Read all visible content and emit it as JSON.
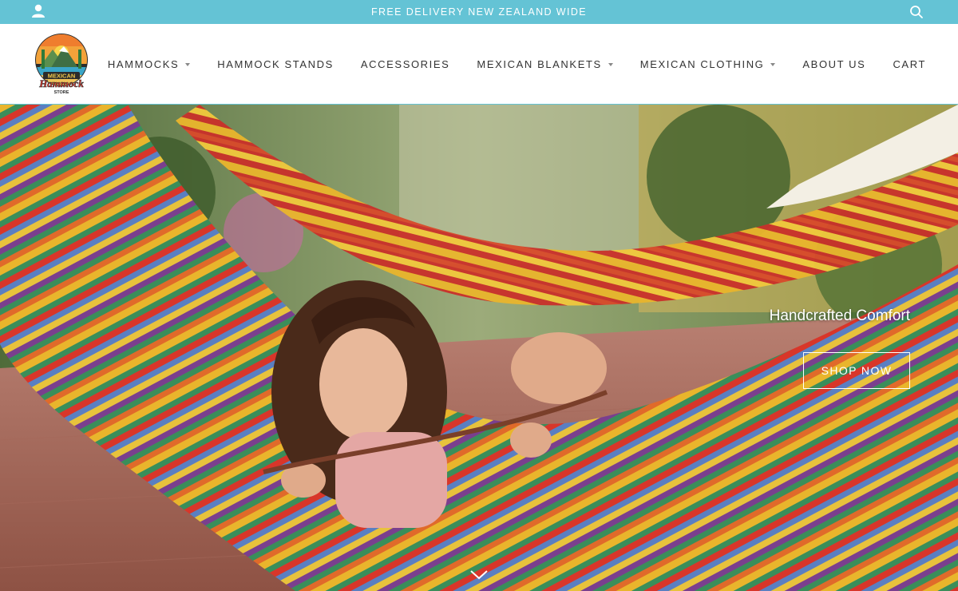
{
  "announcement": {
    "text": "FREE DELIVERY NEW ZEALAND WIDE",
    "account_icon": "user-icon",
    "search_icon": "search-icon"
  },
  "header": {
    "logo": {
      "line1": "MEXICAN",
      "line2": "Hammock",
      "line3": "STORE"
    },
    "nav": [
      {
        "label": "HAMMOCKS",
        "dropdown": true
      },
      {
        "label": "HAMMOCK STANDS",
        "dropdown": false
      },
      {
        "label": "ACCESSORIES",
        "dropdown": false
      },
      {
        "label": "MEXICAN BLANKETS",
        "dropdown": true
      },
      {
        "label": "MEXICAN CLOTHING",
        "dropdown": true
      },
      {
        "label": "ABOUT US",
        "dropdown": false
      },
      {
        "label": "CART",
        "dropdown": false
      }
    ]
  },
  "hero": {
    "title": "Handcrafted Comfort",
    "button_label": "SHOP NOW",
    "scroll_icon": "chevron-down-icon"
  },
  "colors": {
    "topbar": "#64c3d5",
    "nav_text": "#333333",
    "white": "#ffffff"
  }
}
